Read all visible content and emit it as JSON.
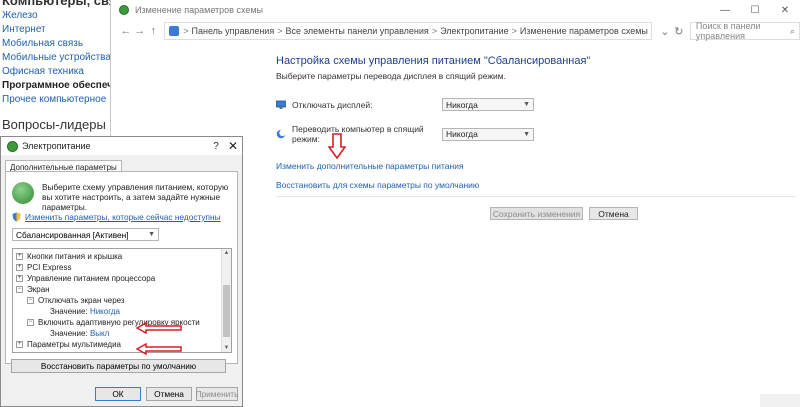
{
  "background_page": {
    "top_text": "Компьютеры, связь",
    "links": [
      "Железо",
      "Интернет",
      "Мобильная связь",
      "Мобильные устройства",
      "Офисная техника"
    ],
    "active_link": "Программное обеспечение",
    "last_link": "Прочее компьютерное",
    "heading": "Вопросы-лидеры"
  },
  "main_window": {
    "title": "Изменение параметров схемы",
    "controls": {
      "minimize": "—",
      "maximize": "☐",
      "close": "✕"
    },
    "nav": {
      "back": "←",
      "forward": "→",
      "up": "↑"
    },
    "breadcrumb": [
      "Панель управления",
      "Все элементы панели управления",
      "Электропитание",
      "Изменение параметров схемы"
    ],
    "breadcrumb_sep": ">",
    "search_placeholder": "Поиск в панели управления",
    "heading": "Настройка схемы управления питанием \"Сбалансированная\"",
    "subheading": "Выберите параметры перевода дисплея в спящий режим.",
    "settings": [
      {
        "label": "Отключать дисплей:",
        "value": "Никогда"
      },
      {
        "label": "Переводить компьютер в спящий режим:",
        "value": "Никогда"
      }
    ],
    "link_advanced": "Изменить дополнительные параметры питания",
    "link_restore": "Восстановить для схемы параметры по умолчанию",
    "save_button": "Сохранить изменения",
    "cancel_button": "Отмена"
  },
  "dialog": {
    "title": "Электропитание",
    "help": "?",
    "close": "✕",
    "tab": "Дополнительные параметры",
    "intro": "Выберите схему управления питанием, которую вы хотите настроить, а затем задайте нужные параметры.",
    "change_link": "Изменить параметры, которые сейчас недоступны",
    "plan": "Сбалансированная [Активен]",
    "tree": [
      {
        "sign": "+",
        "text": "Кнопки питания и крышка"
      },
      {
        "sign": "+",
        "text": "PCI Express"
      },
      {
        "sign": "+",
        "text": "Управление питанием процессора"
      },
      {
        "sign": "−",
        "text": "Экран"
      },
      {
        "sign": "−",
        "text": "Отключать экран через"
      },
      {
        "sign": "",
        "text": "Значение:",
        "value": "Никогда"
      },
      {
        "sign": "−",
        "text": "Включить адаптивную регулировку яркости"
      },
      {
        "sign": "",
        "text": "Значение:",
        "value": "Выкл"
      },
      {
        "sign": "+",
        "text": "Параметры мультимедиа"
      }
    ],
    "restore_button": "Восстановить параметры по умолчанию",
    "ok_button": "ОК",
    "cancel_button": "Отмена",
    "apply_button": "Применить"
  },
  "colors": {
    "accent_link": "#1f5fae",
    "heading_blue": "#1c3f8a",
    "annotation_red": "#d61f26"
  }
}
